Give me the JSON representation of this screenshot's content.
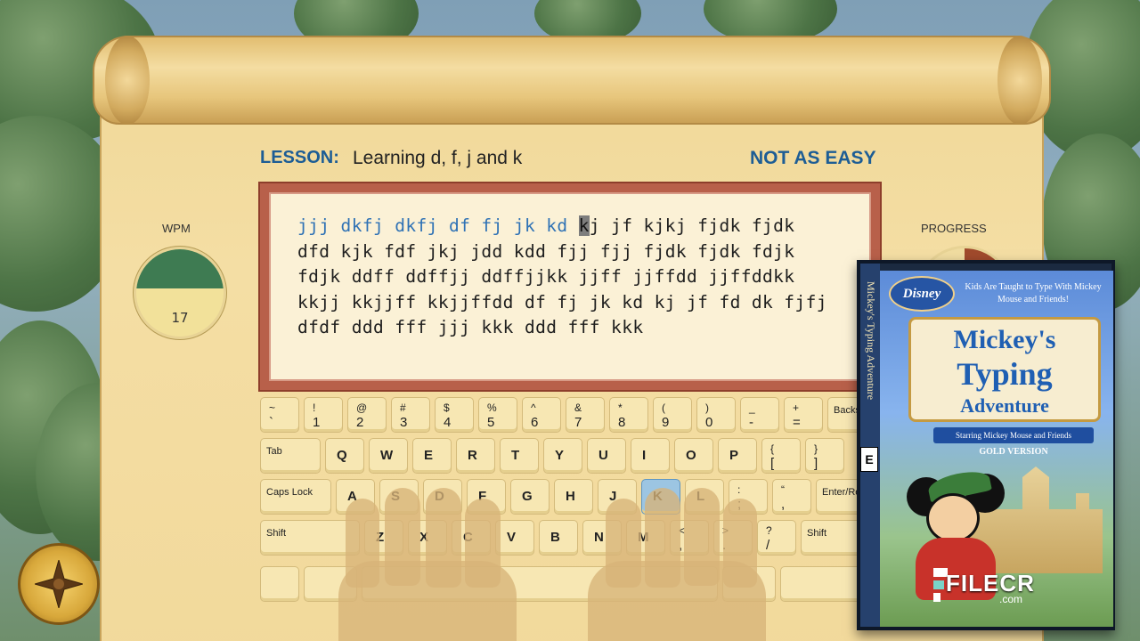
{
  "lesson": {
    "label": "LESSON:",
    "title": "Learning d, f, j and k",
    "difficulty": "NOT AS EASY"
  },
  "typing_text": {
    "typed": "jjj dkfj dkfj df fj jk kd ",
    "cursor_char": "k",
    "line1_rest": "j jf kjkj fjdk fjdk",
    "lines": [
      "dfd kjk fdf jkj jdd kdd fjj fjj fjdk fjdk fdjk",
      "fdjk ddff ddffjj ddffjjkk jjff jjffdd jjffddkk",
      "kkjj kkjjff kkjjffdd df fj jk kd kj jf fd dk fjfj",
      "dfdf ddd fff jjj kkk ddd fff kkk"
    ]
  },
  "wpm": {
    "label": "WPM",
    "value": "17",
    "level": 0.45
  },
  "progress": {
    "label": "PROGRESS",
    "fraction": 0.14
  },
  "keyboard": {
    "highlighted_key": "K",
    "row1": [
      {
        "top": "~",
        "bot": "`"
      },
      {
        "top": "!",
        "bot": "1"
      },
      {
        "top": "@",
        "bot": "2"
      },
      {
        "top": "#",
        "bot": "3"
      },
      {
        "top": "$",
        "bot": "4"
      },
      {
        "top": "%",
        "bot": "5"
      },
      {
        "top": "^",
        "bot": "6"
      },
      {
        "top": "&",
        "bot": "7"
      },
      {
        "top": "*",
        "bot": "8"
      },
      {
        "top": "(",
        "bot": "9"
      },
      {
        "top": ")",
        "bot": "0"
      },
      {
        "top": "_",
        "bot": "-"
      },
      {
        "top": "+",
        "bot": "="
      }
    ],
    "backspace": "Backsp",
    "tab": "Tab",
    "row2": [
      "Q",
      "W",
      "E",
      "R",
      "T",
      "Y",
      "U",
      "I",
      "O",
      "P"
    ],
    "row2_extra": [
      {
        "top": "{",
        "bot": "["
      },
      {
        "top": "}",
        "bot": "]"
      }
    ],
    "caps": "Caps Lock",
    "row3": [
      "A",
      "S",
      "D",
      "F",
      "G",
      "H",
      "J",
      "K",
      "L"
    ],
    "row3_extra": [
      {
        "top": ":",
        "bot": ";"
      },
      {
        "top": "“",
        "bot": ","
      }
    ],
    "enter": "Enter/Re",
    "shift_left": "Shift",
    "row4": [
      "Z",
      "X",
      "C",
      "V",
      "B",
      "N",
      "M"
    ],
    "row4_extra": [
      {
        "top": "<",
        "bot": ","
      },
      {
        "top": ">",
        "bot": "."
      },
      {
        "top": "?",
        "bot": "/"
      }
    ],
    "shift_right": "Shift"
  },
  "boxart": {
    "spine": "Mickey's Typing Adventure",
    "brand": "Disney",
    "tagline": "Kids Are Taught to Type With Mickey Mouse and Friends!",
    "title_1": "Mickey's",
    "title_2": "Typing",
    "title_3": "Adventure",
    "subtitle": "Starring Mickey Mouse and Friends",
    "edition": "GOLD VERSION",
    "rating": "E"
  },
  "watermark": {
    "text": "FILECR",
    "sub": ".com"
  },
  "colors": {
    "accent_blue": "#1d5d95",
    "typed_blue": "#2f72b5",
    "wpm_green": "#3e7b52",
    "frame_red": "#b8604a"
  }
}
